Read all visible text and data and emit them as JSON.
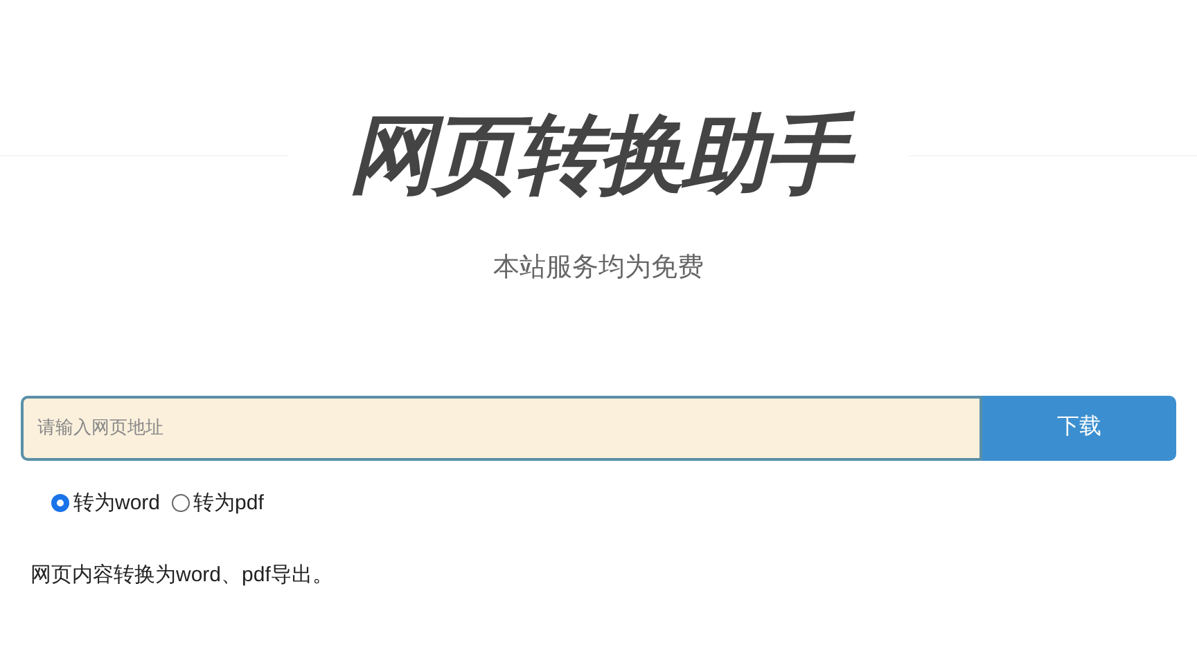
{
  "title": "网页转换助手",
  "subtitle": "本站服务均为免费",
  "url_field": {
    "placeholder": "请输入网页地址"
  },
  "download_button": "下载",
  "formats": [
    {
      "label": "转为word",
      "selected": true
    },
    {
      "label": "转为pdf",
      "selected": false
    }
  ],
  "description": "网页内容转换为word、pdf导出。"
}
